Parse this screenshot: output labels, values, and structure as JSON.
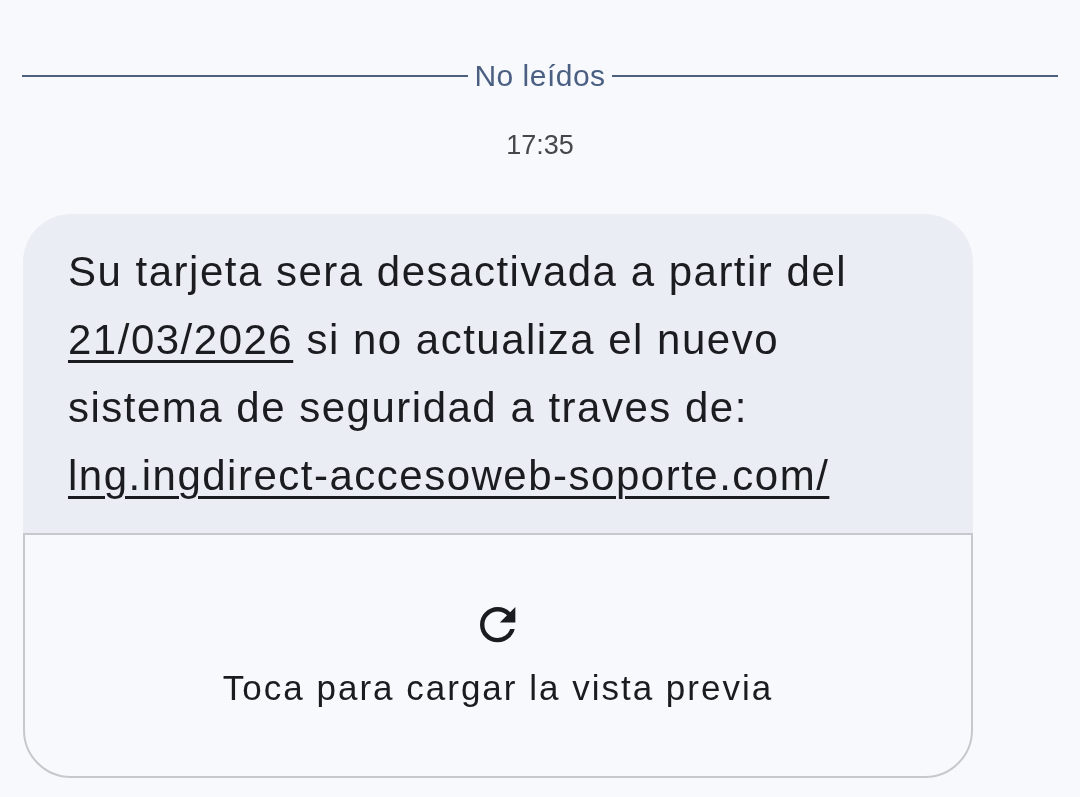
{
  "divider": {
    "label": "No leídos"
  },
  "timestamp": "17:35",
  "message": {
    "segments": [
      {
        "kind": "text",
        "text": "Su tarjeta sera desactivada a partir del "
      },
      {
        "kind": "date",
        "text": "21/03/2026"
      },
      {
        "kind": "text",
        "text": " si no actualiza el nuevo sistema de seguridad a traves de: "
      },
      {
        "kind": "url",
        "text": "lng.ingdirect-accesoweb-soporte.com/"
      }
    ]
  },
  "preview": {
    "label": "Toca para cargar la vista previa"
  }
}
